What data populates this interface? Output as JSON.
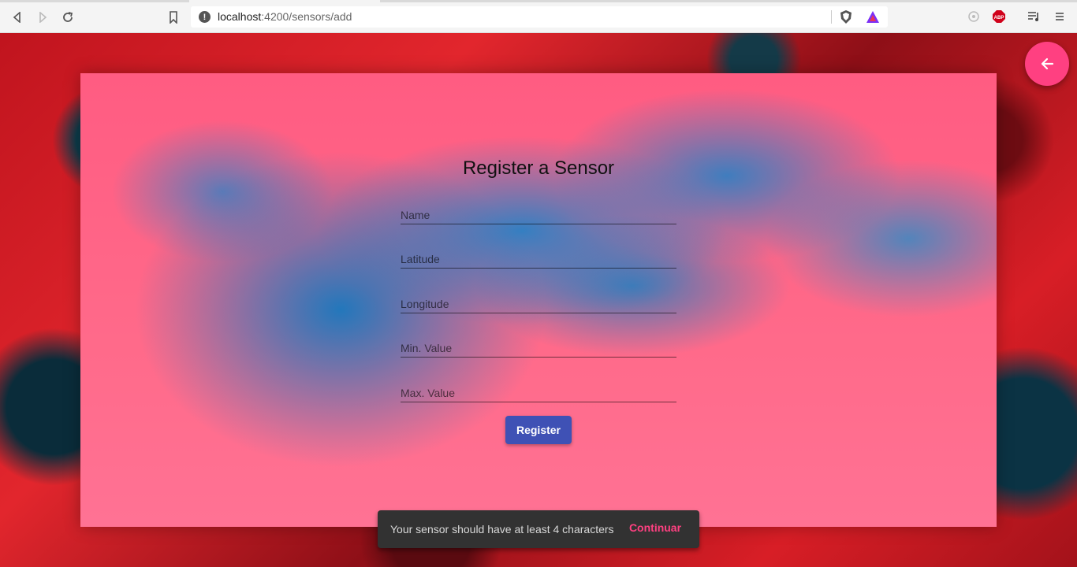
{
  "browser": {
    "url_host": "localhost",
    "url_rest": ":4200/sensors/add"
  },
  "form": {
    "title": "Register a Sensor",
    "fields": [
      {
        "placeholder": "Name",
        "value": ""
      },
      {
        "placeholder": "Latitude",
        "value": ""
      },
      {
        "placeholder": "Longitude",
        "value": ""
      },
      {
        "placeholder": "Min. Value",
        "value": ""
      },
      {
        "placeholder": "Max. Value",
        "value": ""
      }
    ],
    "submit_label": "Register"
  },
  "snackbar": {
    "message": "Your sensor should have at least 4 characters",
    "action_label": "Continuar"
  },
  "colors": {
    "primary": "#3f51b5",
    "accent": "#ff4081",
    "snackbar_bg": "#323232"
  },
  "icons": {
    "fab": "arrow-left-icon"
  }
}
